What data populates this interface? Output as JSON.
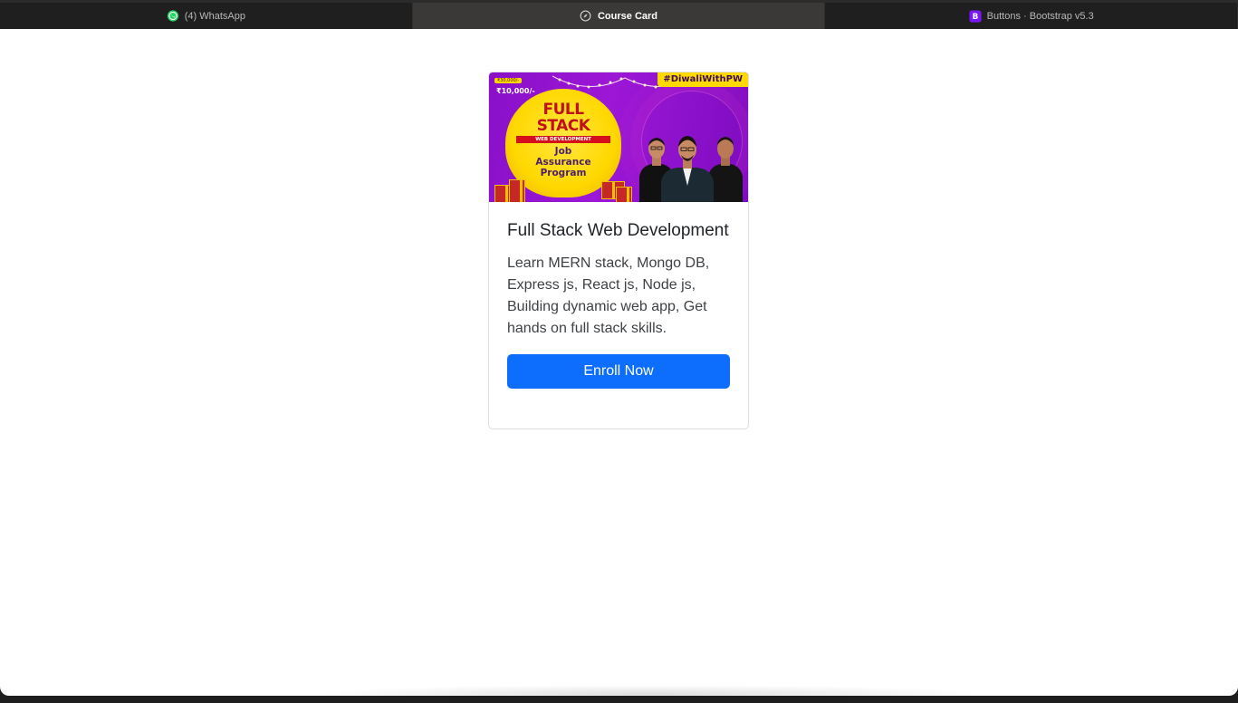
{
  "browser": {
    "tabs": [
      {
        "label": "(4) WhatsApp",
        "icon": "whatsapp-icon",
        "active": false
      },
      {
        "label": "Course Card",
        "icon": "compass-icon",
        "active": true
      },
      {
        "label": "Buttons · Bootstrap v5.3",
        "icon": "bootstrap-icon",
        "active": false
      }
    ]
  },
  "card": {
    "image": {
      "tag": "#DiwaliWithPW",
      "old_price": "₹30,000/-",
      "new_price": "₹10,000/-",
      "badge_title_line1": "FULL",
      "badge_title_line2": "STACK",
      "badge_ribbon": "WEB DEVELOPMENT",
      "badge_sub_line1": "Job",
      "badge_sub_line2": "Assurance",
      "badge_sub_line3": "Program"
    },
    "title": "Full Stack Web Development",
    "description": "Learn MERN stack, Mongo DB, Express js, React js, Node js, Building dynamic web app, Get hands on full stack skills.",
    "button_label": "Enroll Now"
  },
  "colors": {
    "primary_button": "#0d6efd",
    "banner_purple": "#8a10c8",
    "banner_yellow": "#ffd900",
    "tab_bar": "#1f1f1f",
    "active_tab": "#3b3838"
  }
}
